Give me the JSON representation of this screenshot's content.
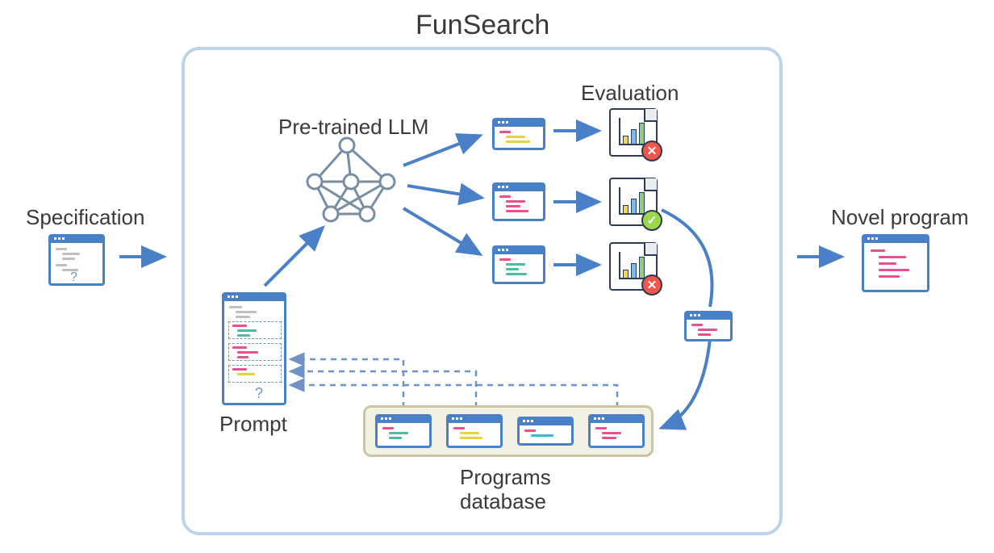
{
  "title": "FunSearch",
  "labels": {
    "specification": "Specification",
    "pretrained": "Pre-trained LLM",
    "evaluation": "Evaluation",
    "prompt": "Prompt",
    "programs_db_l1": "Programs",
    "programs_db_l2": "database",
    "novel_program": "Novel program"
  },
  "colors": {
    "arrow": "#4a80c7",
    "box_border": "#bcd4ea",
    "node_gray": "#778ea3"
  },
  "evaluation_results": [
    "fail",
    "pass",
    "fail"
  ]
}
